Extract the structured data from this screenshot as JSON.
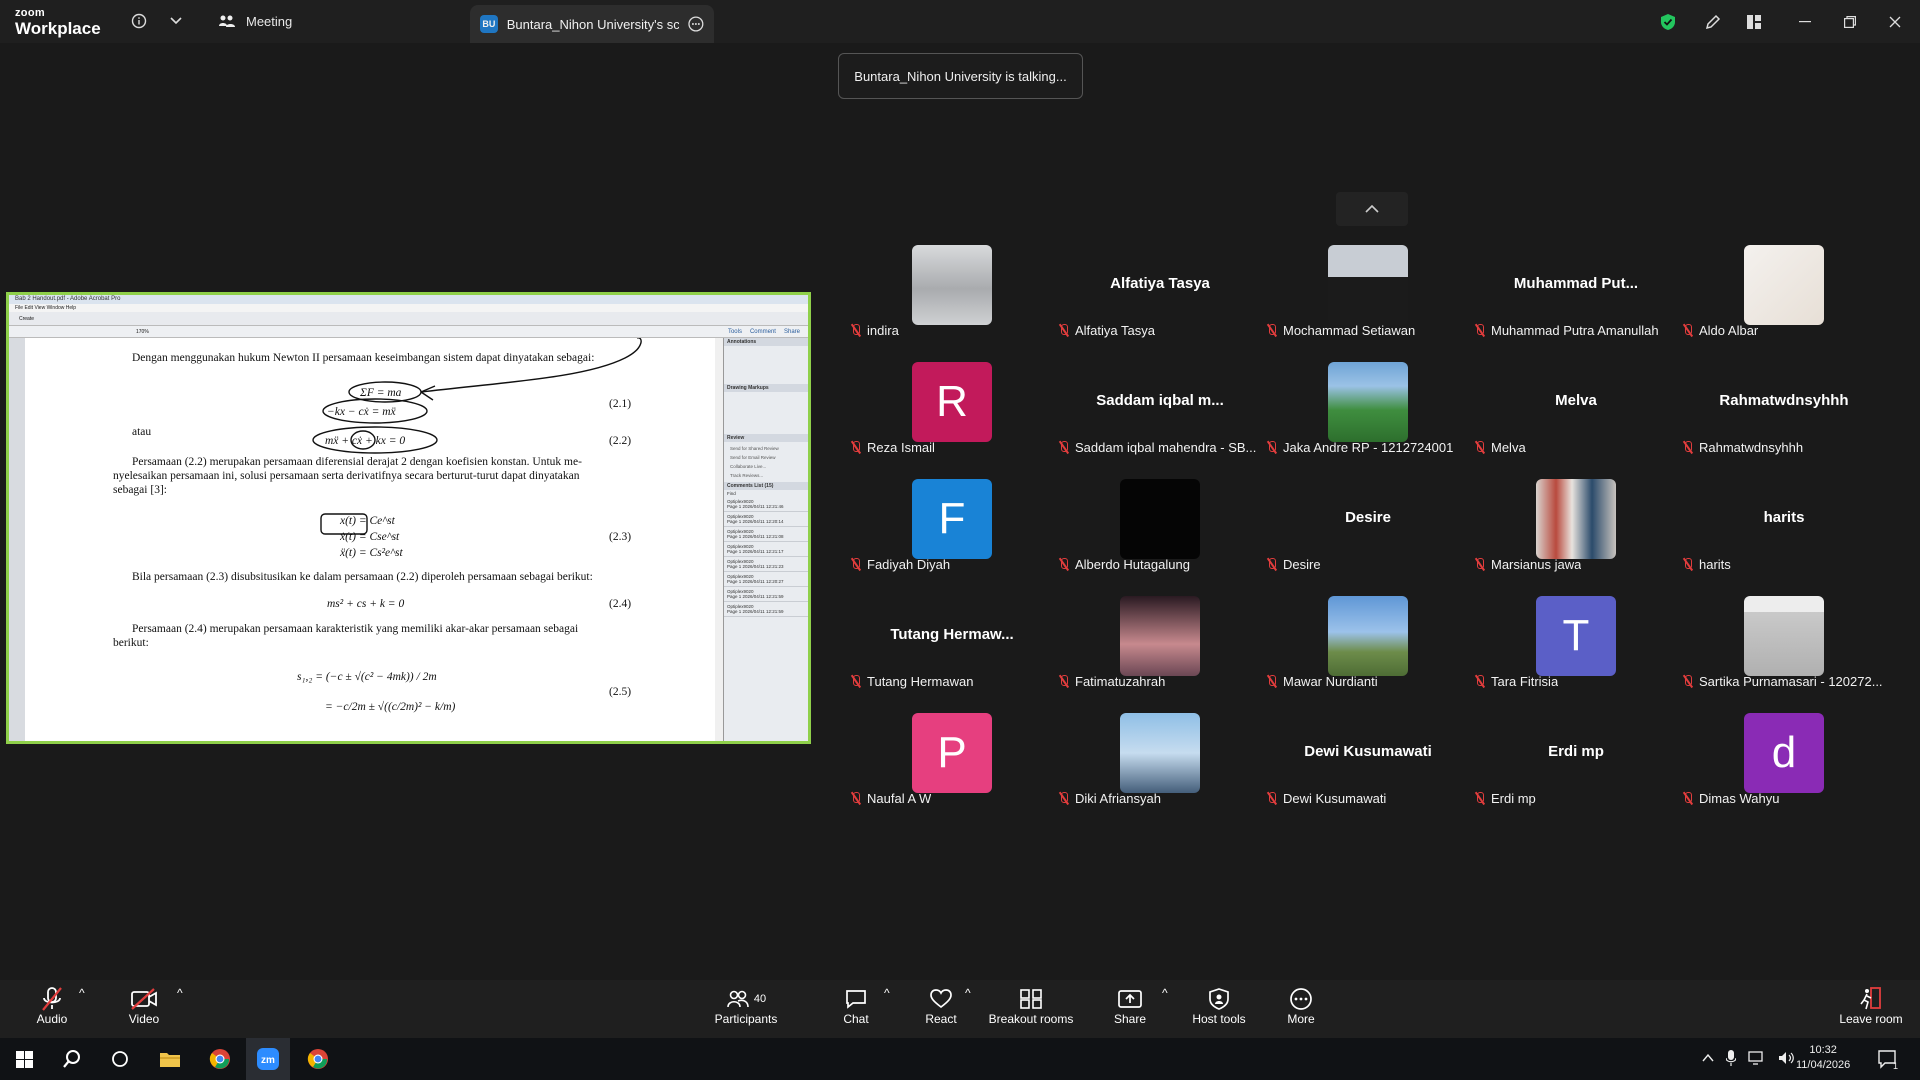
{
  "app": {
    "logo_line1": "zoom",
    "logo_line2": "Workplace"
  },
  "tabs": {
    "meeting": "Meeting",
    "share_badge": "BU",
    "share": "Buntara_Nihon University's screen"
  },
  "talking": "Buntara_Nihon University is talking...",
  "acrobat": {
    "title": "Bab 2 Handout.pdf - Adobe Acrobat Pro",
    "menu": "File  Edit  View  Window  Help",
    "create": "Create",
    "zoom": "170%",
    "panes": [
      "Tools",
      "Comment",
      "Share"
    ],
    "right_sections": [
      "Annotations",
      "Drawing Markups",
      "Review",
      "Comments List (15)"
    ],
    "review_items": [
      "Send for Shared Review",
      "Send for Email Review",
      "Collaborate Live...",
      "Track Reviews..."
    ],
    "find": "Find",
    "comment_rows": [
      {
        "author": "Optiplex9020",
        "meta": "Page 1 2026/04/11 12:21:46"
      },
      {
        "author": "Optiplex9020",
        "meta": "Page 1 2026/04/11 12:20:14"
      },
      {
        "author": "Optiplex9020",
        "meta": "Page 1 2026/04/11 12:21:08"
      },
      {
        "author": "Optiplex9020",
        "meta": "Page 1 2026/04/11 12:21:17"
      },
      {
        "author": "Optiplex9020",
        "meta": "Page 1 2026/04/11 12:21:23"
      },
      {
        "author": "Optiplex9020",
        "meta": "Page 1 2026/04/11 12:20:27"
      },
      {
        "author": "Optiplex9020",
        "meta": "Page 1 2026/04/11 12:21:59"
      },
      {
        "author": "Optiplex9020",
        "meta": "Page 1 2026/04/11 12:21:59"
      }
    ]
  },
  "document": {
    "p1": "Dengan menggunakan hukum Newton II persamaan keseimbangan sistem dapat dinyatakan sebagai:",
    "eq1a": "ΣF = ma",
    "eq1b": "−kx − cẋ = mẍ",
    "eq1n": "(2.1)",
    "atau": "atau",
    "eq2": "mẍ + cẋ + kx = 0",
    "eq2n": "(2.2)",
    "p2a": "Persamaan (2.2) merupakan persamaan diferensial derajat 2 dengan koefisien konstan. Untuk me-",
    "p2b": "nyelesaikan persamaan ini, solusi persamaan serta derivatifnya secara berturut-turut dapat dinyatakan",
    "p2c": "sebagai [3]:",
    "eq3a": "x(t) = Ce^st",
    "eq3b": "ẋ(t) = Cse^st",
    "eq3c": "ẍ(t) = Cs²e^st",
    "eq3n": "(2.3)",
    "p3": "Bila persamaan (2.3) disubsitusikan ke dalam persamaan (2.2) diperoleh persamaan sebagai berikut:",
    "eq4": "ms² + cs + k = 0",
    "eq4n": "(2.4)",
    "p4a": "Persamaan (2.4) merupakan persamaan karakteristik yang memiliki akar-akar persamaan sebagai",
    "p4b": "berikut:",
    "eq5a": "s₁,₂ = (−c ± √(c² − 4mk)) / 2m",
    "eq5b": "= −c/2m ± √((c/2m)² − k/m)",
    "eq5n": "(2.5)"
  },
  "participants": [
    {
      "name": "indira",
      "photo": "ph-blur"
    },
    {
      "name": "Alfatiya Tasya",
      "big": "Alfatiya Tasya"
    },
    {
      "name": "Mochammad Setiawan",
      "photo": "ph-boy"
    },
    {
      "name": "Muhammad Putra Amanullah",
      "big": "Muhammad  Put..."
    },
    {
      "name": "Aldo Albar",
      "photo": "ph-sketch"
    },
    {
      "name": "Reza Ismail",
      "letter": "R",
      "color": "#c21a5b"
    },
    {
      "name": "Saddam iqbal mahendra - SB...",
      "big": "Saddam  iqbal  m..."
    },
    {
      "name": "Jaka Andre RP - 1212724001",
      "photo": "ph-field"
    },
    {
      "name": "Melva",
      "big": "Melva"
    },
    {
      "name": "Rahmatwdnsyhhh",
      "big": "Rahmatwdnsyhhh"
    },
    {
      "name": "Fadiyah Diyah",
      "letter": "F",
      "color": "#1983d6"
    },
    {
      "name": "Alberdo Hutagalung",
      "photo": "ph-dark"
    },
    {
      "name": "Desire",
      "big": "Desire"
    },
    {
      "name": "Marsianus jawa",
      "photo": "ph-room"
    },
    {
      "name": "harits",
      "big": "harits"
    },
    {
      "name": "Tutang Hermawan",
      "big": "Tutang  Hermaw..."
    },
    {
      "name": "Fatimatuzahrah",
      "photo": "ph-girl"
    },
    {
      "name": "Mawar Nurdianti",
      "photo": "ph-sky"
    },
    {
      "name": "Tara Fitrisia",
      "letter": "T",
      "color": "#5b5fc7"
    },
    {
      "name": "Sartika Purnamasari - 120272...",
      "photo": "ph-hijab"
    },
    {
      "name": "Naufal A W",
      "letter": "P",
      "color": "#e63f7f"
    },
    {
      "name": "Diki Afriansyah",
      "photo": "ph-boat"
    },
    {
      "name": "Dewi Kusumawati",
      "big": "Dewi Kusumawati"
    },
    {
      "name": "Erdi mp",
      "big": "Erdi mp"
    },
    {
      "name": "Dimas Wahyu",
      "letter": "d",
      "color": "#8a2bb5"
    }
  ],
  "toolbar": {
    "audio": "Audio",
    "video": "Video",
    "participants": "Participants",
    "participants_count": "40",
    "chat": "Chat",
    "react": "React",
    "breakout": "Breakout rooms",
    "share": "Share",
    "host_tools": "Host tools",
    "more": "More",
    "leave": "Leave room"
  },
  "taskbar": {
    "time": "10:32",
    "date": "11/04/2026",
    "notif": "1"
  },
  "colors": {
    "share_border": "#8fd04a",
    "muted": "#e23d3d",
    "shield": "#23c55e"
  }
}
